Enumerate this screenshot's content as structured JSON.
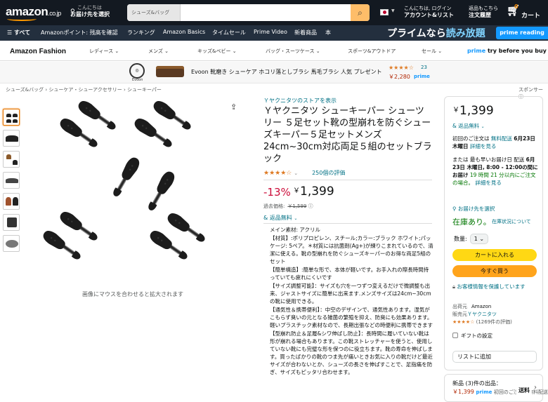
{
  "header": {
    "logo": "amazon",
    "logo_suffix": ".co.jp",
    "deliver_line1": "こんにちは",
    "deliver_line2": "お届け先を選択",
    "search_category": "シューズ&バッグ",
    "search_value": "",
    "account_line1": "こんにちは, ログイン",
    "account_line2": "アカウント&リスト",
    "orders_line1": "返品もこちら",
    "orders_line2": "注文履歴",
    "cart_count": "0",
    "cart_label": "カート"
  },
  "nav": {
    "all": "すべて",
    "items": [
      "Amazonポイント: 残高を確認",
      "ランキング",
      "Amazon Basics",
      "タイムセール",
      "Prime Video",
      "新着商品",
      "本"
    ],
    "prime_banner_a": "プライムなら",
    "prime_banner_b": "読み放題",
    "prime_reading": "prime reading"
  },
  "fashion_nav": {
    "title": "Amazon Fashion",
    "items": [
      "レディース",
      "メンズ",
      "キッズ&ベビー",
      "バッグ・スーツケース",
      "スポーツ&アウトドア",
      "セール"
    ],
    "prime_try_a": "prime",
    "prime_try_b": "try before you buy"
  },
  "ad": {
    "brand": "Evoon",
    "text": "Evoon 靴磨き シューケア ホコリ落としブラシ 馬毛ブラシ 人気 プレゼント",
    "stars": "★★★★☆",
    "rating_count": "23",
    "price": "￥2,280",
    "prime": "prime"
  },
  "breadcrumb": "シューズ&バッグ › シューケア・シューアクセサリー › シューキーパー",
  "sponsor": "スポンサー",
  "hover_text": "画像にマウスを合わせると拡大されます",
  "product": {
    "store": "Ｙヤクニタツのストアを表示",
    "title": "Ｙヤクニタツ シューキーパー シューツリー ５足セット靴の型崩れを防ぐシューズキーパー５足セットメンズ24cm~30cm対応両足５組のセットブラック",
    "stars": "★★★★☆",
    "rating_count": "250個の評価",
    "discount": "-13%",
    "price_symbol": "￥",
    "price": "1,399",
    "list_price_label": "過去価格:",
    "list_price": "￥1,599",
    "returns": "& 返品無料",
    "bullets": [
      "メイン素材: アクリル",
      "【材質】:ポリプロピレン、スチール;カラー:ブラック ホワイト;パッケージ: 5ペア。＊材質には抗菌剤(Ag+)が練りこまれているので、清潔に使える。靴の型崩れを防ぐシューズキーパーのお得な両足5組のセット",
      "【簡単構造】:簡単な形で、本体が軽いです。お手入れの際長時間持っていても疲れにくいです",
      "【サイズ調整可能】：サイズも穴を一つずつ変えるだけで微調整も出来、ジャストサイズに簡単に出来ます.メンズサイズは24cm~30cmの靴に使用できる。",
      "【通気性＆携帯便利】：中空のデザインで、通気性あります。湿気がこもらず臭いの元となる雑菌の繁殖を抑え、防臭にも効果あります。軽いプラスチック素材なので、長期出張などの時便利に携帯できます",
      "【型崩れ防止＆足履&シワ伸ばし防止】：長時間に履いていない靴は形が崩れる場合もあります。この靴ストレッチャーを使うと、使用していない靴にも完璧な形を保つのに役立ちます。靴の寿命を伸ばします。買ったばかりの靴のつま先が痛いときお気に入りの靴だけど最近サイズが合わないとか、シューズの長さを伸ばすことで、足指痛を防ぎ、サイズもピッタリ合わせます。"
    ]
  },
  "buybox": {
    "price_symbol": "￥",
    "price": "1,399",
    "returns": "& 返品無料",
    "delivery1_a": "初回のご注文は",
    "delivery1_b": "無料配送",
    "delivery1_c": "6月23日 木曜日",
    "delivery1_d": "詳細を見る",
    "delivery2_a": "または 最も早いお届け日 配送",
    "delivery2_b": "6月23日 木曜日,",
    "delivery2_c": "8:00 - 12:00の間にお届け",
    "delivery2_d": "19 時間 21 分以内にご注文の場合。",
    "delivery2_e": "詳細を見る",
    "address": "お届け先を選択",
    "stock": "在庫あり。",
    "stock_note": "在庫状況について",
    "qty_label": "数量:",
    "qty_value": "1",
    "add_to_cart": "カートに入れる",
    "buy_now": "今すぐ買う",
    "secure": "お客様情報を保護しています",
    "ship_from_label": "出荷元",
    "ship_from": "Amazon",
    "seller_label": "販売元",
    "seller": "Ｙヤクニタツ",
    "seller_stars": "★★★★☆",
    "seller_rating": "(1269件の評価)",
    "gift": "ギフトの設定",
    "add_to_list": "リストに追加",
    "new_offers": "新品 (3)件の出品：",
    "new_price": "￥1,399",
    "new_prime": "prime",
    "new_delivery": "初回のご注文は無料配送",
    "float_btn": "送料"
  }
}
